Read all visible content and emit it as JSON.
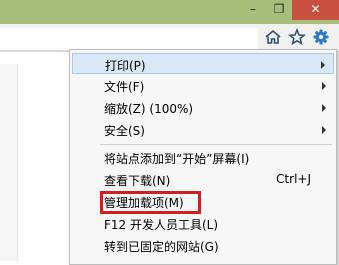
{
  "colors": {
    "titlebar": "#a7be7a",
    "close_button": "#c7503e",
    "menu_highlight": "#d9e8f7",
    "annotation_box": "#d11f1f"
  },
  "window": {
    "minimize_glyph": "–",
    "maximize_glyph": "❐",
    "close_glyph": "✕"
  },
  "toolbar": {
    "icons": [
      "home-icon",
      "favorites-star-icon",
      "tools-gear-icon"
    ]
  },
  "menu": {
    "items": [
      {
        "label": "打印(P)",
        "submenu": true,
        "highlighted": true
      },
      {
        "label": "文件(F)",
        "submenu": true
      },
      {
        "label": "缩放(Z) (100%)",
        "submenu": true
      },
      {
        "label": "安全(S)",
        "submenu": true
      },
      {
        "label": "将站点添加到“开始”屏幕(I)"
      },
      {
        "label": "查看下载(N)",
        "shortcut": "Ctrl+J"
      },
      {
        "label": "管理加载项(M)",
        "annotated": true
      },
      {
        "label": "F12 开发人员工具(L)"
      },
      {
        "label": "转到已固定的网站(G)"
      }
    ]
  }
}
